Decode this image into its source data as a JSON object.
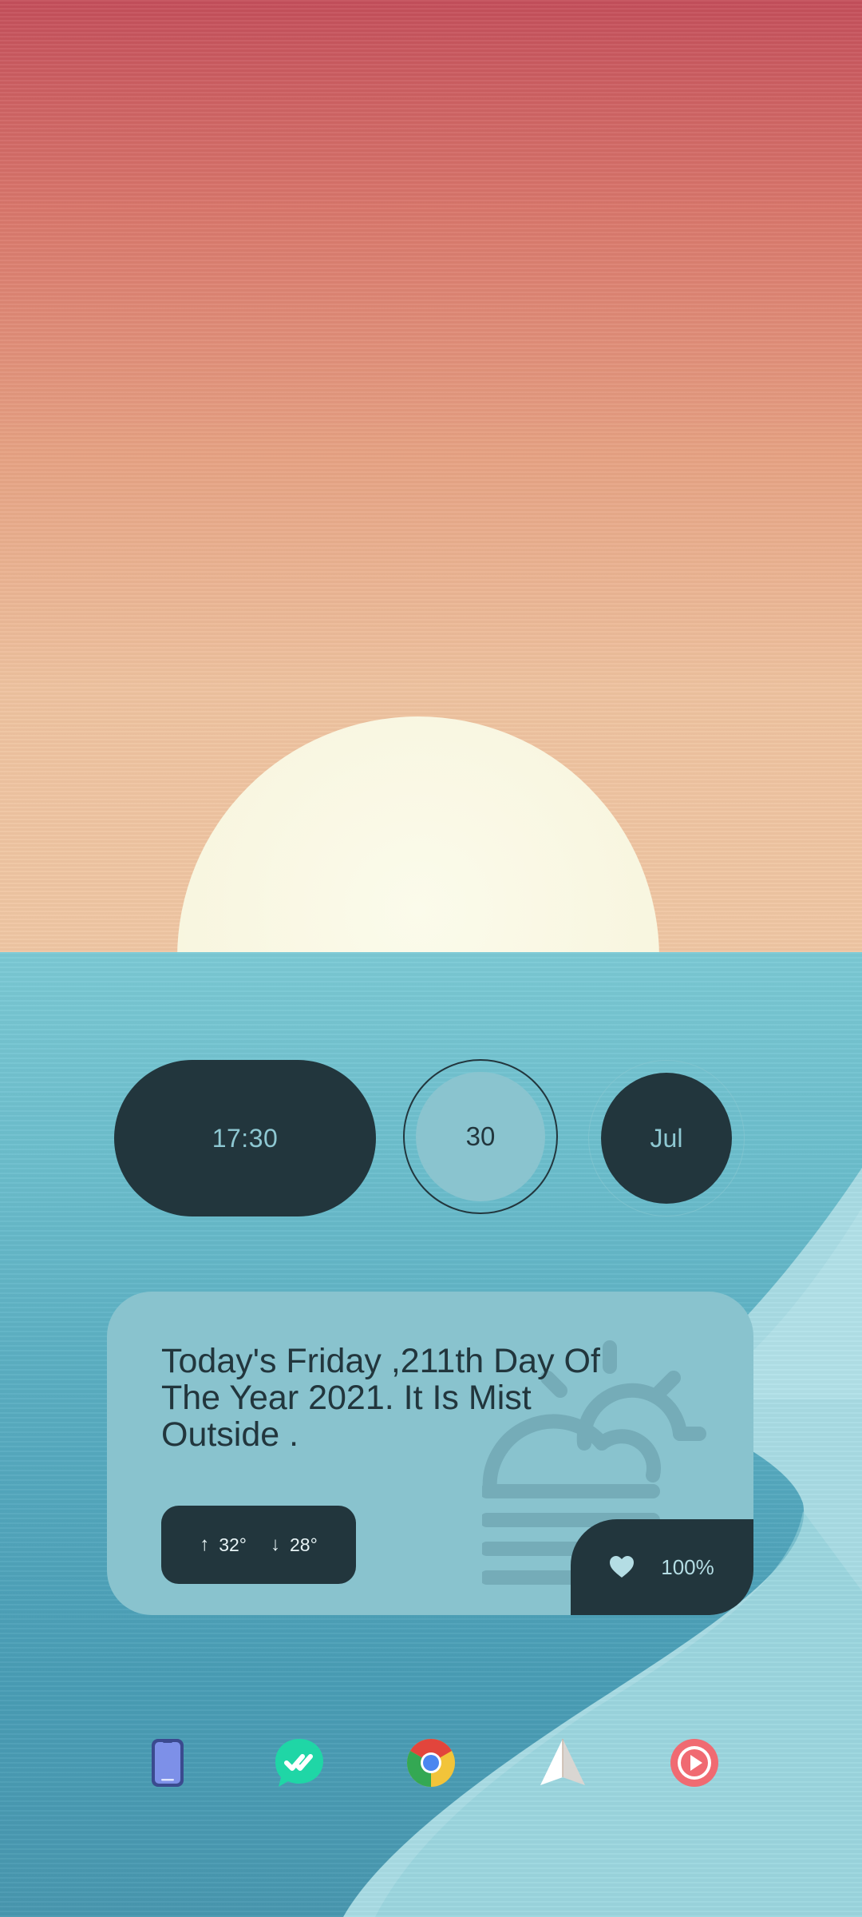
{
  "wallpaper": {
    "sky_top": "#c44f5b",
    "sky_bottom": "#efc6a3",
    "sun": "#f8f5de",
    "sea": "#5aaec2",
    "shore": "#a8dbe3"
  },
  "widgets": {
    "time": "17:30",
    "day": "30",
    "month": "Jul"
  },
  "info_card": {
    "message": "Today's Friday ,211th Day Of The Year 2021. It Is Mist Outside .",
    "weather_icon": "sun-behind-clouds-mist-icon",
    "high_temp": "32°",
    "low_temp": "28°",
    "battery": "100%",
    "battery_icon": "heart-icon"
  },
  "dock": {
    "apps": [
      {
        "icon": "phone-icon"
      },
      {
        "icon": "messaging-icon"
      },
      {
        "icon": "chrome-icon"
      },
      {
        "icon": "paper-plane-icon"
      },
      {
        "icon": "music-play-icon"
      }
    ]
  },
  "colors": {
    "widget_dark": "#22363d",
    "widget_light": "#89c3ce",
    "accent_text": "#8ec8d2"
  }
}
